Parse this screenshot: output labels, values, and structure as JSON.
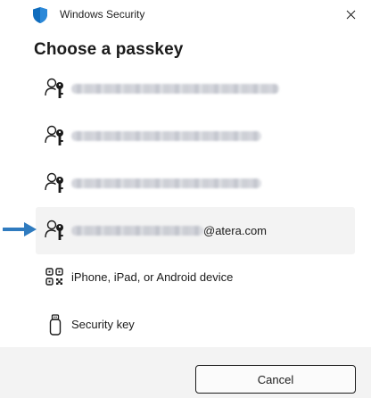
{
  "window": {
    "title": "Windows Security"
  },
  "heading": "Choose a passkey",
  "options": [
    {
      "icon": "passkey-icon",
      "label": "",
      "suffix": ""
    },
    {
      "icon": "passkey-icon",
      "label": "",
      "suffix": ""
    },
    {
      "icon": "passkey-icon",
      "label": "",
      "suffix": ""
    },
    {
      "icon": "passkey-icon",
      "label": "",
      "suffix": "@atera.com",
      "selected": true
    },
    {
      "icon": "qr-code-icon",
      "label": "iPhone, iPad, or Android device"
    },
    {
      "icon": "security-key-icon",
      "label": "Security key"
    }
  ],
  "footer": {
    "cancel_label": "Cancel"
  },
  "colors": {
    "arrow": "#2f7bbf",
    "selected_row": "#f3f3f3",
    "shield": "#0f6cbd"
  }
}
